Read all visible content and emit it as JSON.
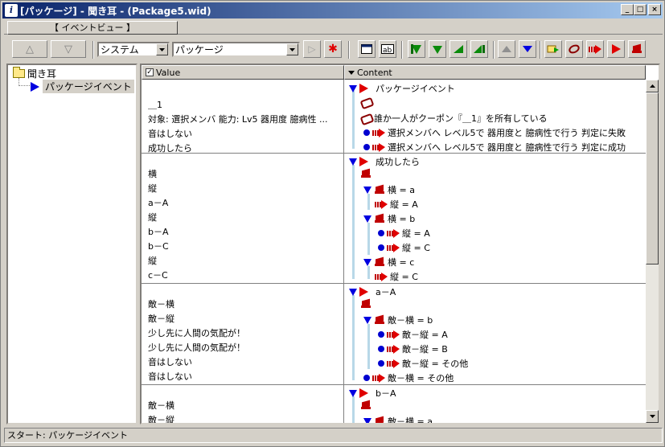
{
  "window": {
    "title": "[パッケージ] - 聞き耳 - (Package5.wid)",
    "app_icon": "app-logo-icon",
    "minimize": "_",
    "maximize": "□",
    "close": "×"
  },
  "tabs": [
    {
      "label": "【 イベントビュー 】"
    }
  ],
  "toolbar": {
    "up_arrow": "△",
    "down_arrow": "▽",
    "system_select": "システム",
    "package_select": "パッケージ",
    "play_arrow": "▷",
    "star": "✱"
  },
  "tree": {
    "root_label": "聞き耳",
    "child_label": "パッケージイベント"
  },
  "grid": {
    "value_header": "Value",
    "content_header": "Content",
    "value_checked": "✓",
    "blocks": [
      {
        "values": [
          "",
          "＿1",
          "対象: 選択メンバ 能力: Lv5 器用度 臆病性 ...",
          "音はしない",
          "成功したら"
        ],
        "contents": [
          {
            "text": "パッケージイベント"
          },
          {
            "text": ""
          },
          {
            "text": "誰か一人がクーポン『＿1』を所有している"
          },
          {
            "text": "選択メンバへ レベル5で 器用度と 臆病性で行う 判定に失敗"
          },
          {
            "text": "選択メンバへ レベル5で 器用度と 臆病性で行う 判定に成功"
          }
        ]
      },
      {
        "values": [
          "",
          "",
          "横",
          "縦",
          "a－A",
          "縦",
          "b－A",
          "b－C",
          "縦",
          "c－C"
        ],
        "contents": [
          {
            "text": "成功したら"
          },
          {
            "text": ""
          },
          {
            "text": "横 = a"
          },
          {
            "text": "縦 = A"
          },
          {
            "text": "横 = b"
          },
          {
            "text": "縦 = A"
          },
          {
            "text": "縦 = C"
          },
          {
            "text": "横 = c"
          },
          {
            "text": "縦 = C"
          }
        ]
      },
      {
        "values": [
          "",
          "",
          "敵－横",
          "敵－縦",
          "少し先に人間の気配が！",
          "少し先に人間の気配が！",
          "音はしない",
          "音はしない"
        ],
        "contents": [
          {
            "text": "a－A"
          },
          {
            "text": ""
          },
          {
            "text": "敵－横 = b"
          },
          {
            "text": "敵－縦 = A"
          },
          {
            "text": "敵－縦 = B"
          },
          {
            "text": "敵－縦 = その他"
          },
          {
            "text": "敵－横 = その他"
          }
        ]
      },
      {
        "values": [
          "",
          "",
          "敵－横",
          "敵－縦"
        ],
        "contents": [
          {
            "text": "b－A"
          },
          {
            "text": ""
          },
          {
            "text": "敵－横 = a"
          }
        ]
      }
    ]
  },
  "status": {
    "text": "スタート: パッケージイベント"
  },
  "colors": {
    "title_bar_start": "#0a246a",
    "title_bar_end": "#a6caf0",
    "face": "#d4d0c8",
    "accent_red": "#e00000",
    "accent_blue": "#0000e0"
  }
}
